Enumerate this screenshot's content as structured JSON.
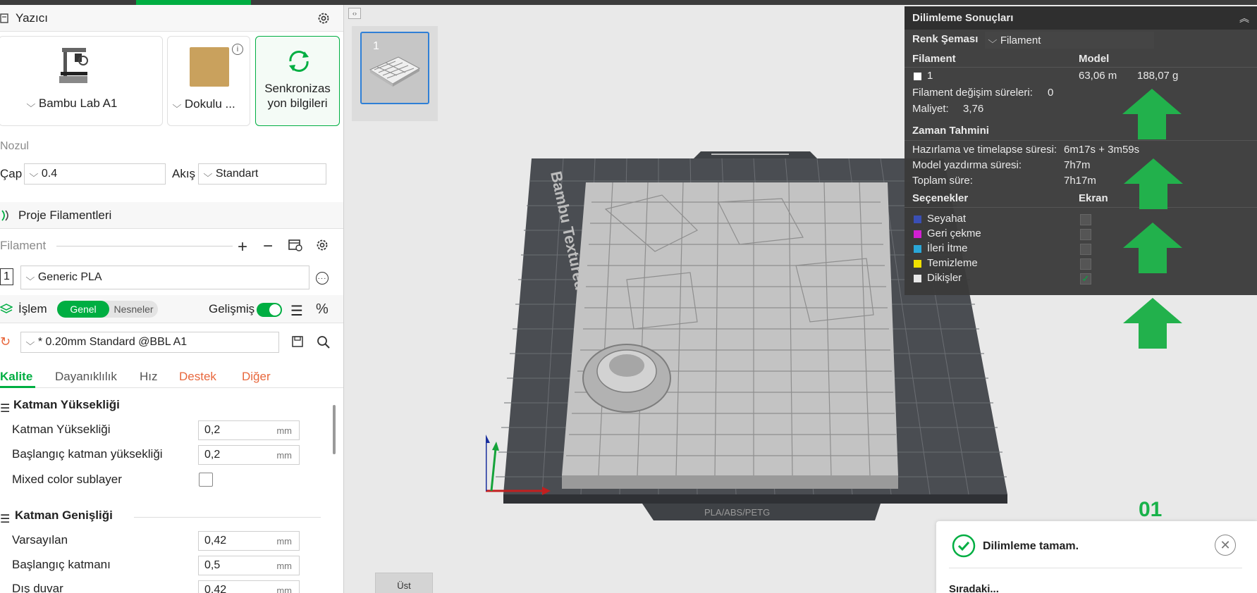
{
  "printer": {
    "section_title": "Yazıcı",
    "printer_name": "Bambu Lab A1",
    "plate_name": "Dokulu ...",
    "sync_label_line1": "Senkronizas",
    "sync_label_line2": "yon bilgileri",
    "nozzle_title": "Nozul",
    "diameter_label": "Çap",
    "diameter_value": "0.4",
    "flow_label": "Akış",
    "flow_value": "Standart"
  },
  "filaments": {
    "section_title": "Proje Filamentleri",
    "filament_label": "Filament",
    "slot_number": "1",
    "filament_name": "Generic PLA"
  },
  "process": {
    "section_title": "İşlem",
    "toggle_general": "Genel",
    "toggle_objects": "Nesneler",
    "advanced_label": "Gelişmiş",
    "profile_name": "* 0.20mm Standard @BBL A1",
    "tabs": [
      "Kalite",
      "Dayanıklılık",
      "Hız",
      "Destek",
      "Diğer"
    ],
    "groups": {
      "layer_height_title": "Katman Yüksekliği",
      "line_width_title": "Katman Genişliği"
    },
    "params": {
      "layer_height_label": "Katman Yüksekliği",
      "layer_height_value": "0,2",
      "initial_layer_height_label": "Başlangıç katman yüksekliği",
      "initial_layer_height_value": "0,2",
      "mixed_color_label": "Mixed color sublayer",
      "default_width_label": "Varsayılan",
      "default_width_value": "0,42",
      "initial_layer_width_label": "Başlangıç katmanı",
      "initial_layer_width_value": "0,5",
      "outer_wall_label": "Dış duvar",
      "outer_wall_value": "0,42",
      "unit": "mm"
    }
  },
  "viewport": {
    "plate_number": "1",
    "bed_label": "Bambu Textured PEI Plate",
    "bed_bottom_label": "PLA/ABS/PETG",
    "plate_index": "01",
    "view_tab_label": "Üst"
  },
  "results": {
    "title": "Dilimleme Sonuçları",
    "color_scheme_label": "Renk Şeması",
    "color_scheme_value": "Filament",
    "col_filament": "Filament",
    "col_model": "Model",
    "filament_row_id": "1",
    "filament_length": "63,06 m",
    "filament_weight": "188,07 g",
    "change_times_label": "Filament değişim süreleri:",
    "change_times_value": "0",
    "cost_label": "Maliyet:",
    "cost_value": "3,76",
    "time_title": "Zaman Tahmini",
    "prep_label": "Hazırlama ve timelapse süresi:",
    "prep_value": "6m17s + 3m59s",
    "model_print_label": "Model yazdırma süresi:",
    "model_print_value": "7h7m",
    "total_label": "Toplam süre:",
    "total_value": "7h17m",
    "options_title": "Seçenekler",
    "display_title": "Ekran",
    "options": [
      {
        "label": "Seyahat",
        "color": "#3a4fb5",
        "checked": false
      },
      {
        "label": "Geri çekme",
        "color": "#d21fd2",
        "checked": false
      },
      {
        "label": "İleri İtme",
        "color": "#2aa7d8",
        "checked": false
      },
      {
        "label": "Temizleme",
        "color": "#f0e000",
        "checked": false
      },
      {
        "label": "Dikişler",
        "color": "#e8e8e8",
        "checked": true
      }
    ]
  },
  "toast": {
    "message": "Dilimleme tamam.",
    "next_line": "Sıradaki..."
  },
  "colors": {
    "accent_green": "#00ae42",
    "arrow_green": "#22b14c",
    "danger_tab": "#e8673c"
  }
}
